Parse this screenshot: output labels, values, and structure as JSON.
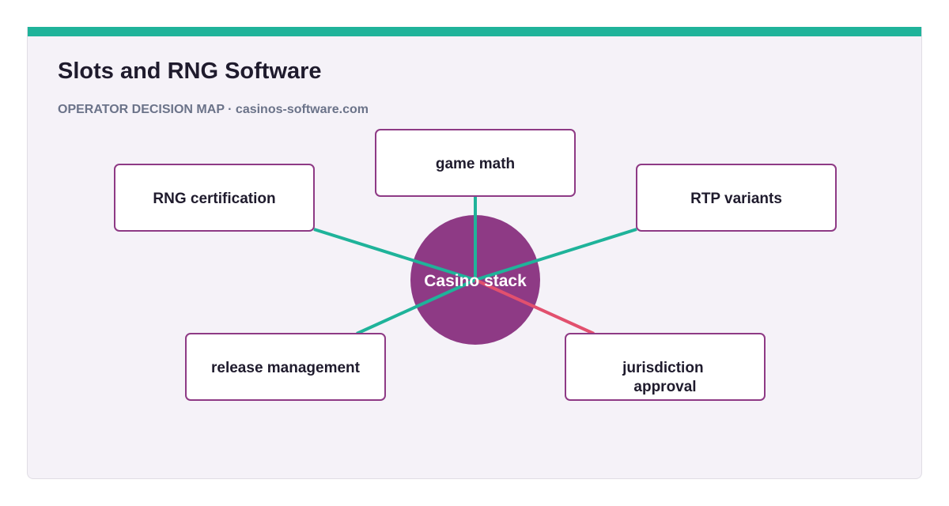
{
  "header": {
    "title": "Slots and RNG Software",
    "subtitle": "OPERATOR DECISION MAP · casinos-software.com"
  },
  "colors": {
    "accent": "#1fb39a",
    "hub": "#8e3a85",
    "edge_default": "#1fb39a",
    "edge_highlight": "#e2506e",
    "node_border": "#8e3a85"
  },
  "diagram": {
    "hub": {
      "label": "Casino stack"
    },
    "nodes": [
      {
        "id": "rng-certification",
        "label": "RNG certification",
        "edge": "default"
      },
      {
        "id": "game-math",
        "label": "game math",
        "edge": "default"
      },
      {
        "id": "rtp-variants",
        "label": "RTP variants",
        "edge": "default"
      },
      {
        "id": "release-management",
        "label": "release management",
        "edge": "default"
      },
      {
        "id": "jurisdiction-approval",
        "label": "jurisdiction approval",
        "label_lines": [
          "jurisdiction",
          "approval"
        ],
        "edge": "highlight"
      }
    ]
  }
}
